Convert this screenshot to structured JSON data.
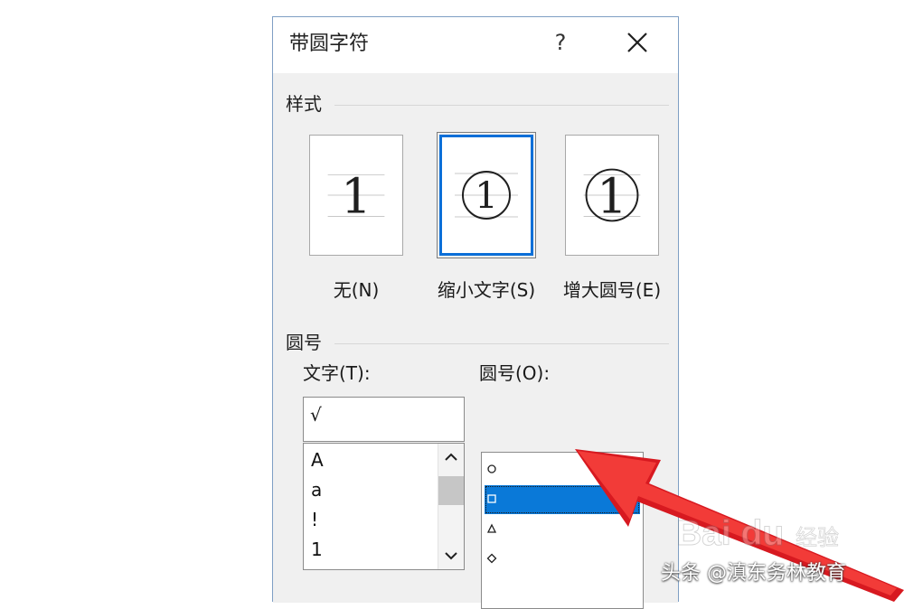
{
  "dialog": {
    "title": "带圆字符",
    "help_button": "?",
    "close_icon": "close-icon"
  },
  "style_section": {
    "label": "样式",
    "options": [
      {
        "caption": "无(N)",
        "glyph": "1",
        "selected": false
      },
      {
        "caption": "缩小文字(S)",
        "glyph": "1",
        "selected": true
      },
      {
        "caption": "增大圆号(E)",
        "glyph": "1",
        "selected": false
      }
    ]
  },
  "enclosure_section": {
    "label": "圆号",
    "text_label": "文字(T):",
    "circle_label": "圆号(O):",
    "text_value": "√",
    "text_items": [
      "A",
      "a",
      "!",
      "1"
    ],
    "circle_items": [
      {
        "glyph": "small-circle-icon"
      },
      {
        "glyph": "small-square-icon"
      },
      {
        "glyph": "small-triangle-icon"
      },
      {
        "glyph": "small-diamond-icon"
      }
    ],
    "selected_circle_index": 1
  },
  "colors": {
    "selection": "#0a79d8",
    "annotation_arrow": "#e3141d",
    "dialog_body": "#f0f0f0",
    "dialog_border": "#7f9fc4"
  },
  "watermark": {
    "brand": "Bai du",
    "subtitle": "经验"
  },
  "credit": {
    "text": "头条 @滇东务林教育"
  }
}
